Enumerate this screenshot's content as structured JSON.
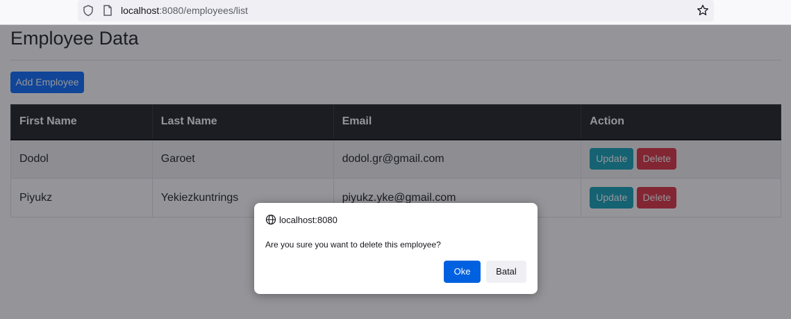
{
  "browser": {
    "url_host": "localhost",
    "url_rest": ":8080/employees/list"
  },
  "page": {
    "title": "Employee Data",
    "add_button": "Add Employee"
  },
  "table": {
    "headers": [
      "First Name",
      "Last Name",
      "Email",
      "Action"
    ],
    "rows": [
      {
        "first_name": "Dodol",
        "last_name": "Garoet",
        "email": "dodol.gr@gmail.com",
        "update_label": "Update",
        "delete_label": "Delete"
      },
      {
        "first_name": "Piyukz",
        "last_name": "Yekiezkuntrings",
        "email": "piyukz.yke@gmail.com",
        "update_label": "Update",
        "delete_label": "Delete"
      }
    ]
  },
  "dialog": {
    "origin": "localhost:8080",
    "message": "Are you sure you want to delete this employee?",
    "ok_label": "Oke",
    "cancel_label": "Batal"
  },
  "colors": {
    "primary": "#0d6efd",
    "info": "#17a2b8",
    "danger": "#dc3545",
    "dark": "#212529",
    "dialog_accent": "#0061e0"
  }
}
